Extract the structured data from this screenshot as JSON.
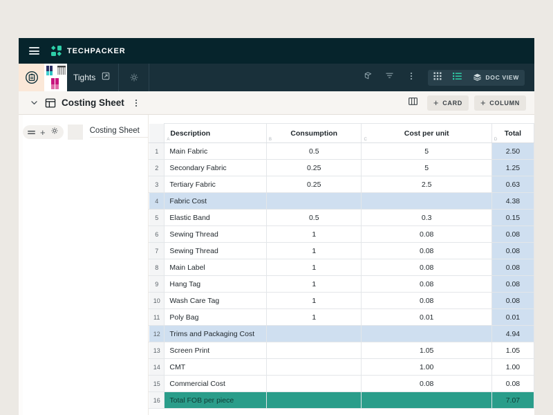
{
  "brand": {
    "name": "TECHPACKER",
    "menu_icon": "hamburger-icon",
    "logo_icon": "techpacker-logo-icon",
    "accent_color": "#2ecfa8",
    "bar_color": "#06242c"
  },
  "doc_bar": {
    "home_icon": "clipboard-icon",
    "tab": {
      "label": "Tights",
      "thumbnail_icon": "tights-thumbnail",
      "open_external_icon": "external-link-icon"
    },
    "settings_icon": "gear-icon",
    "tools": [
      {
        "icon": "duplicate-icon",
        "name": "duplicate-button"
      },
      {
        "icon": "filter-icon",
        "name": "filter-button"
      },
      {
        "icon": "more-vertical-icon",
        "name": "more-options-button"
      }
    ],
    "view_switch": {
      "grid_icon": "grid-view-icon",
      "list_icon": "list-view-icon",
      "doc_icon": "layers-icon",
      "doc_label": "DOC VIEW",
      "active": "list",
      "active_color": "#2ecfa8"
    }
  },
  "sheet_header": {
    "collapse_icon": "chevron-down-icon",
    "sheet_icon": "table-layout-icon",
    "title": "Costing Sheet",
    "more_icon": "more-vertical-icon",
    "columns_icon": "columns-icon",
    "add_card_label": "CARD",
    "add_column_label": "COLUMN",
    "plus_glyph": "+"
  },
  "left_pane": {
    "drag_icon": "drag-handle-icon",
    "add_glyph": "+",
    "settings_icon": "gear-icon",
    "card_name": "Costing Sheet"
  },
  "table": {
    "column_letters": [
      "A",
      "B",
      "C",
      "D"
    ],
    "headers": [
      "Description",
      "Consumption",
      "Cost per unit",
      "Total"
    ],
    "rows": [
      {
        "n": "1",
        "desc": "Main Fabric",
        "cons": "0.5",
        "cpu": "5",
        "total": "2.50",
        "style": "normal"
      },
      {
        "n": "2",
        "desc": "Secondary Fabric",
        "cons": "0.25",
        "cpu": "5",
        "total": "1.25",
        "style": "normal"
      },
      {
        "n": "3",
        "desc": "Tertiary Fabric",
        "cons": "0.25",
        "cpu": "2.5",
        "total": "0.63",
        "style": "normal"
      },
      {
        "n": "4",
        "desc": "Fabric Cost",
        "cons": "",
        "cpu": "",
        "total": "4.38",
        "style": "subtotal"
      },
      {
        "n": "5",
        "desc": "Elastic Band",
        "cons": "0.5",
        "cpu": "0.3",
        "total": "0.15",
        "style": "normal"
      },
      {
        "n": "6",
        "desc": "Sewing Thread",
        "cons": "1",
        "cpu": "0.08",
        "total": "0.08",
        "style": "normal"
      },
      {
        "n": "7",
        "desc": "Sewing Thread",
        "cons": "1",
        "cpu": "0.08",
        "total": "0.08",
        "style": "normal"
      },
      {
        "n": "8",
        "desc": "Main Label",
        "cons": "1",
        "cpu": "0.08",
        "total": "0.08",
        "style": "normal"
      },
      {
        "n": "9",
        "desc": "Hang Tag",
        "cons": "1",
        "cpu": "0.08",
        "total": "0.08",
        "style": "normal"
      },
      {
        "n": "10",
        "desc": "Wash Care Tag",
        "cons": "1",
        "cpu": "0.08",
        "total": "0.08",
        "style": "normal"
      },
      {
        "n": "11",
        "desc": "Poly Bag",
        "cons": "1",
        "cpu": "0.01",
        "total": "0.01",
        "style": "normal"
      },
      {
        "n": "12",
        "desc": "Trims and Packaging Cost",
        "cons": "",
        "cpu": "",
        "total": "4.94",
        "style": "subtotal"
      },
      {
        "n": "13",
        "desc": "Screen Print",
        "cons": "",
        "cpu": "1.05",
        "total": "1.05",
        "style": "plain-total"
      },
      {
        "n": "14",
        "desc": "CMT",
        "cons": "",
        "cpu": "1.00",
        "total": "1.00",
        "style": "plain-total"
      },
      {
        "n": "15",
        "desc": "Commercial Cost",
        "cons": "",
        "cpu": "0.08",
        "total": "0.08",
        "style": "plain-total"
      },
      {
        "n": "16",
        "desc": "Total FOB per piece",
        "cons": "",
        "cpu": "",
        "total": "7.07",
        "style": "grand"
      }
    ],
    "colors": {
      "subtotal_row": "#cfdff0",
      "grand_total_row": "#2a9d8a",
      "total_column": "#cfdff0"
    }
  }
}
